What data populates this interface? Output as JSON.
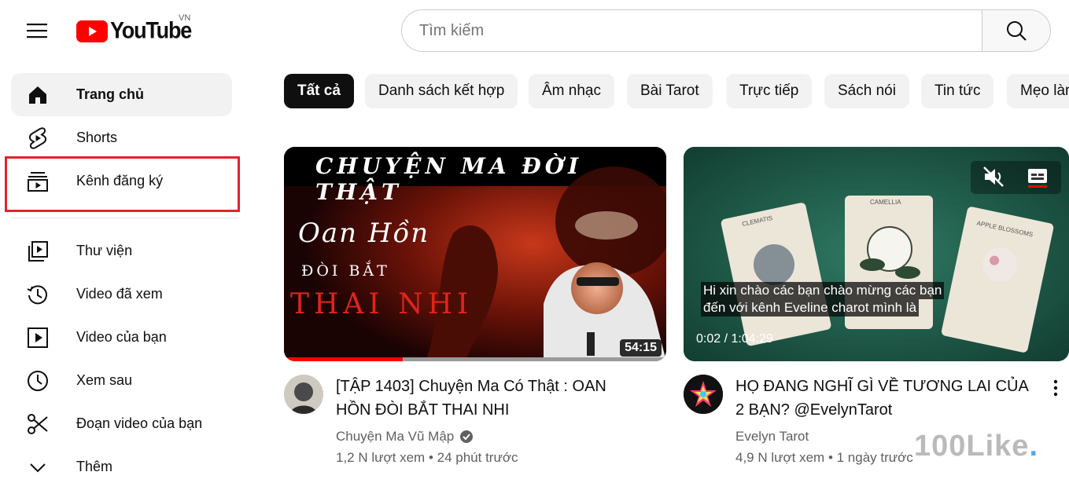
{
  "header": {
    "logo_text": "YouTube",
    "country_code": "VN",
    "search_placeholder": "Tìm kiếm"
  },
  "sidebar": {
    "items": [
      {
        "label": "Trang chủ",
        "icon": "home-icon",
        "active": true
      },
      {
        "label": "Shorts",
        "icon": "shorts-icon"
      },
      {
        "label": "Kênh đăng ký",
        "icon": "subscriptions-icon",
        "highlighted": true
      },
      {
        "label": "Thư viện",
        "icon": "library-icon"
      },
      {
        "label": "Video đã xem",
        "icon": "history-icon"
      },
      {
        "label": "Video của bạn",
        "icon": "your-videos-icon"
      },
      {
        "label": "Xem sau",
        "icon": "watch-later-icon"
      },
      {
        "label": "Đoạn video của bạn",
        "icon": "clips-icon"
      },
      {
        "label": "Thêm",
        "icon": "chevron-down-icon"
      }
    ]
  },
  "chips": [
    {
      "label": "Tất cả",
      "active": true
    },
    {
      "label": "Danh sách kết hợp"
    },
    {
      "label": "Âm nhạc"
    },
    {
      "label": "Bài Tarot"
    },
    {
      "label": "Trực tiếp"
    },
    {
      "label": "Sách nói"
    },
    {
      "label": "Tin tức"
    },
    {
      "label": "Mẹo làm"
    }
  ],
  "videos": [
    {
      "thumb_title": "CHUYỆN MA ĐỜI THẬT",
      "thumb_line1": "Oan Hồn",
      "thumb_line2": "ĐÒI BẮT",
      "thumb_line3": "THAI NHI",
      "duration": "54:15",
      "watched_fraction": 0.31,
      "title": "[TẬP 1403] Chuyện Ma Có Thật : OAN HỒN ĐÒI BẮT THAI NHI",
      "channel": "Chuyện Ma Vũ Mập",
      "verified": true,
      "meta": "1,2 N lượt xem • 24 phút trước"
    },
    {
      "card1": "CLEMATIS",
      "card2": "CAMELLIA",
      "card3": "APPLE BLOSSOMS",
      "caption_line1": "Hi xin chào các bạn chào mừng các bạn",
      "caption_line2": "đến với kênh Eveline charot mình là",
      "timecode": "0:02 / 1:04:29",
      "title": "HỌ ĐANG NGHĨ GÌ VỀ TƯƠNG LAI CỦA 2 BẠN? @EvelynTarot",
      "channel": "Evelyn Tarot",
      "meta": "4,9 N lượt xem • 1 ngày trước"
    }
  ],
  "watermark": {
    "text": "100Like",
    "dot": "."
  },
  "colors": {
    "brand_red": "#ff0000",
    "highlight_box": "#e0232e",
    "chip_active": "#0f0f0f"
  }
}
